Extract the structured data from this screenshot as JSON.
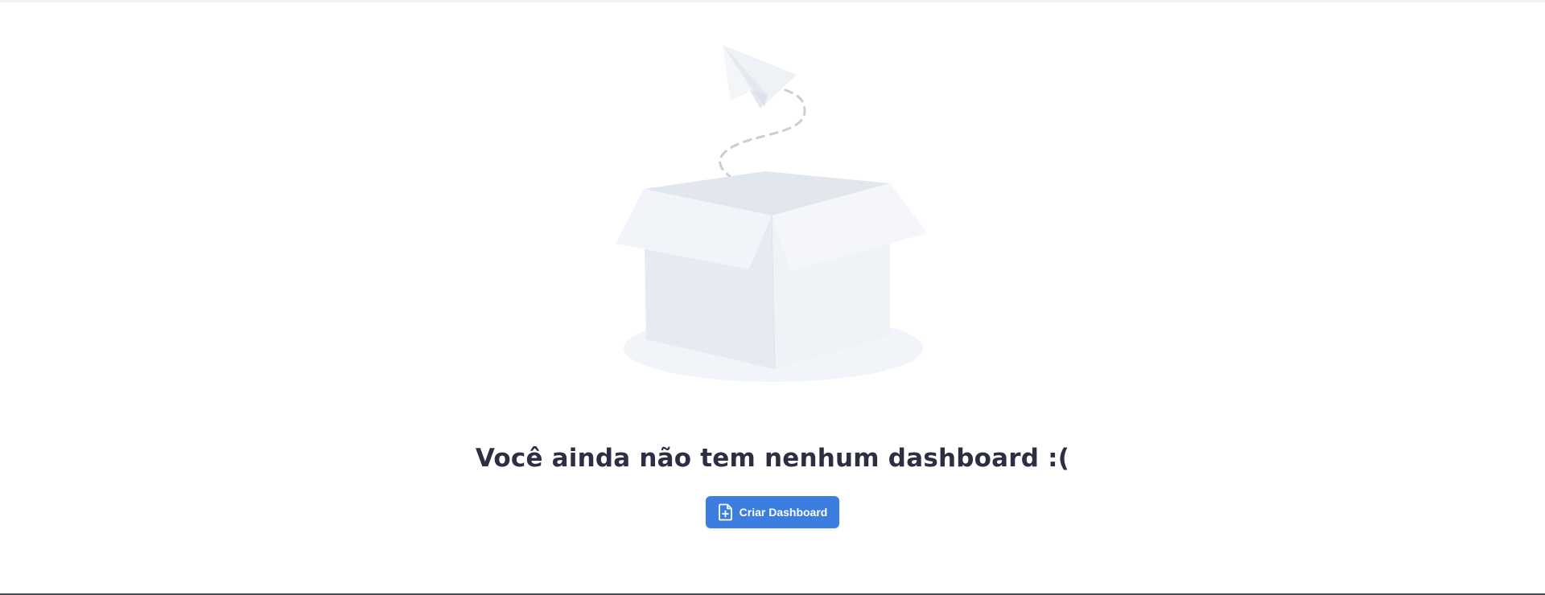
{
  "empty_state": {
    "message": "Você ainda não tem nenhum dashboard :(",
    "illustration": "open-box-paper-plane-illustration"
  },
  "actions": {
    "create_dashboard_label": "Criar Dashboard",
    "create_dashboard_icon": "file-plus-icon"
  },
  "colors": {
    "primary_button": "#3b7ee0",
    "title_text": "#2c2f44",
    "illustration_light": "#eef2f7"
  }
}
